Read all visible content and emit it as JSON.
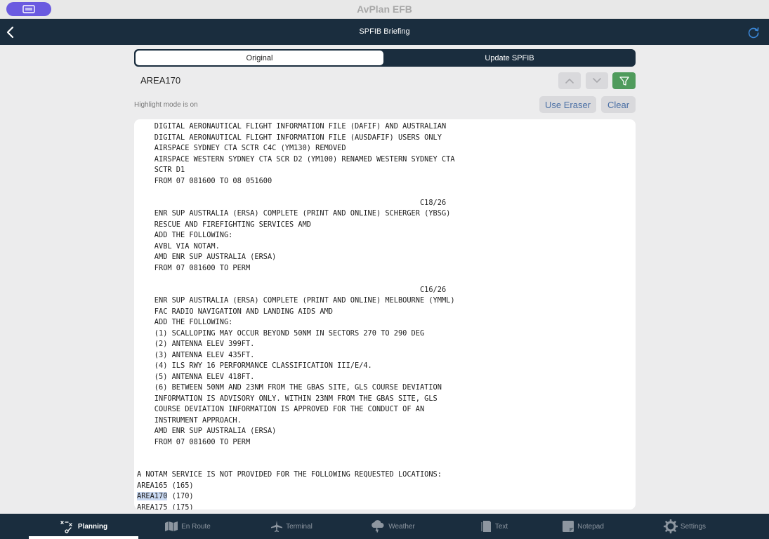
{
  "app": {
    "title": "AvPlan EFB"
  },
  "navbar": {
    "title": "SPFIB Briefing"
  },
  "segments": {
    "original": "Original",
    "update": "Update SPFIB"
  },
  "search": {
    "term": "AREA170"
  },
  "highlight": {
    "status": "Highlight mode is on",
    "eraser_label": "Use Eraser",
    "clear_label": "Clear"
  },
  "document": {
    "lines": [
      "    DIGITAL AERONAUTICAL FLIGHT INFORMATION FILE (DAFIF) AND AUSTRALIAN",
      "    DIGITAL AERONAUTICAL FLIGHT INFORMATION FILE (AUSDAFIF) USERS ONLY",
      "    AIRSPACE SYDNEY CTA SCTR C4C (YM130) REMOVED",
      "    AIRSPACE WESTERN SYDNEY CTA SCR D2 (YM100) RENAMED WESTERN SYDNEY CTA",
      "    SCTR D1",
      "    FROM 07 081600 TO 08 051600",
      "",
      "                                                                 C18/26",
      "    ENR SUP AUSTRALIA (ERSA) COMPLETE (PRINT AND ONLINE) SCHERGER (YBSG)",
      "    RESCUE AND FIREFIGHTING SERVICES AMD",
      "    ADD THE FOLLOWING:",
      "    AVBL VIA NOTAM.",
      "    AMD ENR SUP AUSTRALIA (ERSA)",
      "    FROM 07 081600 TO PERM",
      "",
      "                                                                 C16/26",
      "    ENR SUP AUSTRALIA (ERSA) COMPLETE (PRINT AND ONLINE) MELBOURNE (YMML)",
      "    FAC RADIO NAVIGATION AND LANDING AIDS AMD",
      "    ADD THE FOLLOWING:",
      "    (1) SCALLOPING MAY OCCUR BEYOND 50NM IN SECTORS 270 TO 290 DEG",
      "    (2) ANTENNA ELEV 399FT.",
      "    (3) ANTENNA ELEV 435FT.",
      "    (4) ILS RWY 16 PERFORMANCE CLASSIFICATION III/E/4.",
      "    (5) ANTENNA ELEV 418FT.",
      "    (6) BETWEEN 50NM AND 23NM FROM THE GBAS SITE, GLS COURSE DEVIATION",
      "    INFORMATION IS ADVISORY ONLY. WITHIN 23NM FROM THE GBAS SITE, GLS",
      "    COURSE DEVIATION INFORMATION IS APPROVED FOR THE CONDUCT OF AN",
      "    INSTRUMENT APPROACH.",
      "    AMD ENR SUP AUSTRALIA (ERSA)",
      "    FROM 07 081600 TO PERM",
      "",
      "",
      "A NOTAM SERVICE IS NOT PROVIDED FOR THE FOLLOWING REQUESTED LOCATIONS:",
      "AREA165 (165)"
    ],
    "highlighted_line": {
      "match": "AREA170",
      "rest": " (170)"
    },
    "cut_line": "AREA175 (175)"
  },
  "tabs": [
    {
      "label": "Planning",
      "icon": "route-planning-icon",
      "active": true
    },
    {
      "label": "En Route",
      "icon": "map-icon",
      "active": false
    },
    {
      "label": "Terminal",
      "icon": "airplane-icon",
      "active": false
    },
    {
      "label": "Weather",
      "icon": "weather-cloud-icon",
      "active": false
    },
    {
      "label": "Text",
      "icon": "document-text-icon",
      "active": false
    },
    {
      "label": "Notepad",
      "icon": "notepad-icon",
      "active": false
    },
    {
      "label": "Settings",
      "icon": "gear-icon",
      "active": false
    }
  ],
  "colors": {
    "nav_dark": "#1a2d3e",
    "highlight_green": "#4f9b5c",
    "link_blue": "#4a6fa5",
    "window_pill": "#6a5ae0",
    "text_mark": "#c9d9f2"
  }
}
